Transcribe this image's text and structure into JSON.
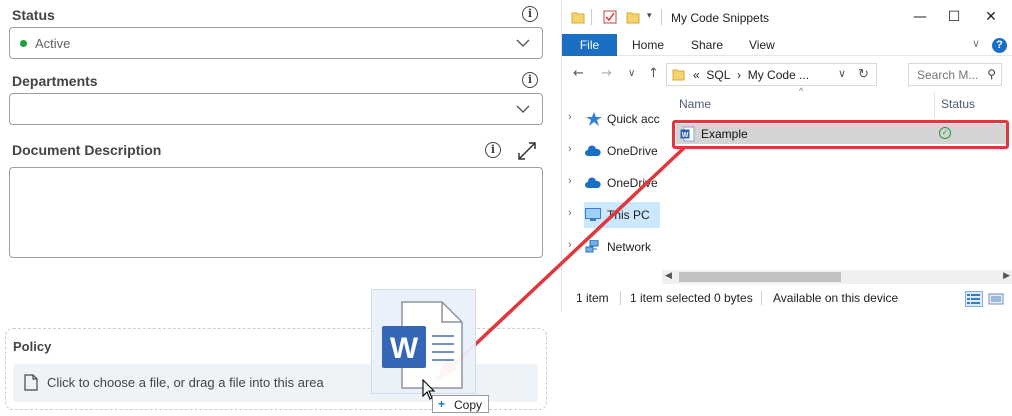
{
  "form": {
    "status": {
      "label": "Status",
      "value": "Active",
      "status_color": "#1f9d3f"
    },
    "departments": {
      "label": "Departments",
      "value": ""
    },
    "description": {
      "label": "Document Description"
    },
    "policy": {
      "label": "Policy",
      "drop_text": "Click to choose a file, or drag a file into this area"
    }
  },
  "explorer": {
    "title": "My Code Snippets",
    "ribbon_tabs": [
      "File",
      "Home",
      "Share",
      "View"
    ],
    "address": {
      "prefix": "«",
      "crumb1": "SQL",
      "sep": "›",
      "crumb2": "My Code ..."
    },
    "search_placeholder": "Search M...",
    "nav_items": [
      {
        "label": "Quick acc",
        "icon": "star-icon"
      },
      {
        "label": "OneDrive",
        "icon": "cloud-icon"
      },
      {
        "label": "OneDrive",
        "icon": "cloud-icon"
      },
      {
        "label": "This PC",
        "icon": "monitor-icon"
      },
      {
        "label": "Network",
        "icon": "network-icon"
      }
    ],
    "columns": {
      "name": "Name",
      "status": "Status"
    },
    "file": {
      "name": "Example",
      "status_icon": "synced-check-icon"
    },
    "statusbar": {
      "count": "1 item",
      "selected": "1 item selected",
      "size": "0 bytes",
      "availability": "Available on this device"
    }
  },
  "drag": {
    "tooltip": "Copy",
    "plus": "+"
  },
  "colors": {
    "accent": "#1a6fc4",
    "highlight": "#e0373c",
    "word_blue": "#2b5fb4"
  }
}
